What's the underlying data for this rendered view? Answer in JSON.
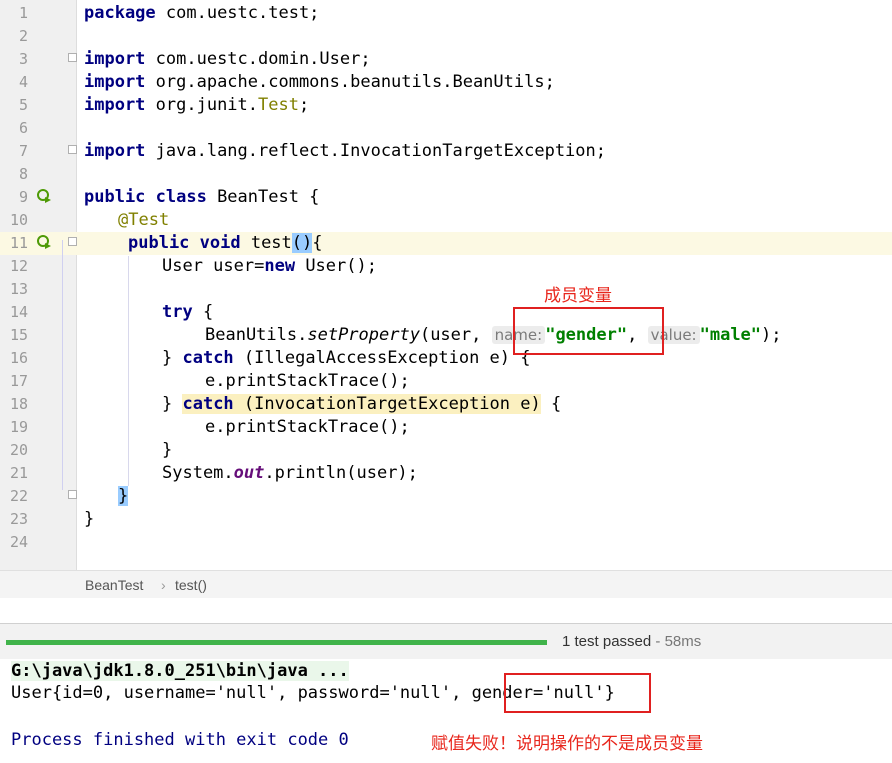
{
  "editor": {
    "lines": [
      {
        "n": "1"
      },
      {
        "n": "2"
      },
      {
        "n": "3"
      },
      {
        "n": "4"
      },
      {
        "n": "5"
      },
      {
        "n": "6"
      },
      {
        "n": "7"
      },
      {
        "n": "8"
      },
      {
        "n": "9"
      },
      {
        "n": "10"
      },
      {
        "n": "11"
      },
      {
        "n": "12"
      },
      {
        "n": "13"
      },
      {
        "n": "14"
      },
      {
        "n": "15"
      },
      {
        "n": "16"
      },
      {
        "n": "17"
      },
      {
        "n": "18"
      },
      {
        "n": "19"
      },
      {
        "n": "20"
      },
      {
        "n": "21"
      },
      {
        "n": "22"
      },
      {
        "n": "23"
      },
      {
        "n": "24"
      }
    ],
    "code": {
      "l1_kw": "package",
      "l1_rest": " com.uestc.test;",
      "l3_kw": "import",
      "l3_rest": " com.uestc.domin.User;",
      "l4_kw": "import",
      "l4_rest": " org.apache.commons.beanutils.BeanUtils;",
      "l5_kw": "import",
      "l5_a": " org.junit.",
      "l5_cls": "Test",
      "l5_b": ";",
      "l7_kw": "import",
      "l7_rest": " java.lang.reflect.InvocationTargetException;",
      "l9_kw": "public class",
      "l9_rest": " BeanTest {",
      "l10_ann": "@Test",
      "l11_kw": "public void",
      "l11_a": " test",
      "l11_paren": "()",
      "l11_brace": "{",
      "l12_a": "User user=",
      "l12_kw": "new",
      "l12_b": " User();",
      "l14_kw": "try",
      "l14_rest": " {",
      "l15_a": "BeanUtils.",
      "l15_m": "setProperty",
      "l15_b": "(user, ",
      "l15_hint1": "name:",
      "l15_str1": "\"gender\"",
      "l15_c": ", ",
      "l15_hint2": "value:",
      "l15_str2": "\"male\"",
      "l15_d": ");",
      "l16_a": "} ",
      "l16_kw": "catch",
      "l16_rest": " (IllegalAccessException e) {",
      "l17": "e.printStackTrace();",
      "l18_a": "} ",
      "l18_kw": "catch",
      "l18_rest": " (InvocationTargetException e)",
      "l18_end": " {",
      "l19": "e.printStackTrace();",
      "l20": "}",
      "l21_a": "System.",
      "l21_f": "out",
      "l21_b": ".println(user);",
      "l22": "}",
      "l23": "}"
    }
  },
  "annotations": {
    "member_var": "成员变量",
    "conclusion": "赋值失败！说明操作的不是成员变量"
  },
  "breadcrumb": {
    "class": "BeanTest",
    "sep": "›",
    "method": "test()"
  },
  "run": {
    "status": "1 test passed",
    "duration": " - 58ms",
    "progress_fraction": 1.0
  },
  "console": {
    "cmd": "G:\\java\\jdk1.8.0_251\\bin\\java ...",
    "output_a": "User{id=0, username='null', password='null', ",
    "output_b": "gender='null'",
    "output_c": "}",
    "exit": "Process finished with exit code 0"
  },
  "colors": {
    "keyword": "#000080",
    "string": "#008000",
    "annotation": "#808000",
    "red_marker": "#e02020",
    "progress": "#40b34a"
  }
}
